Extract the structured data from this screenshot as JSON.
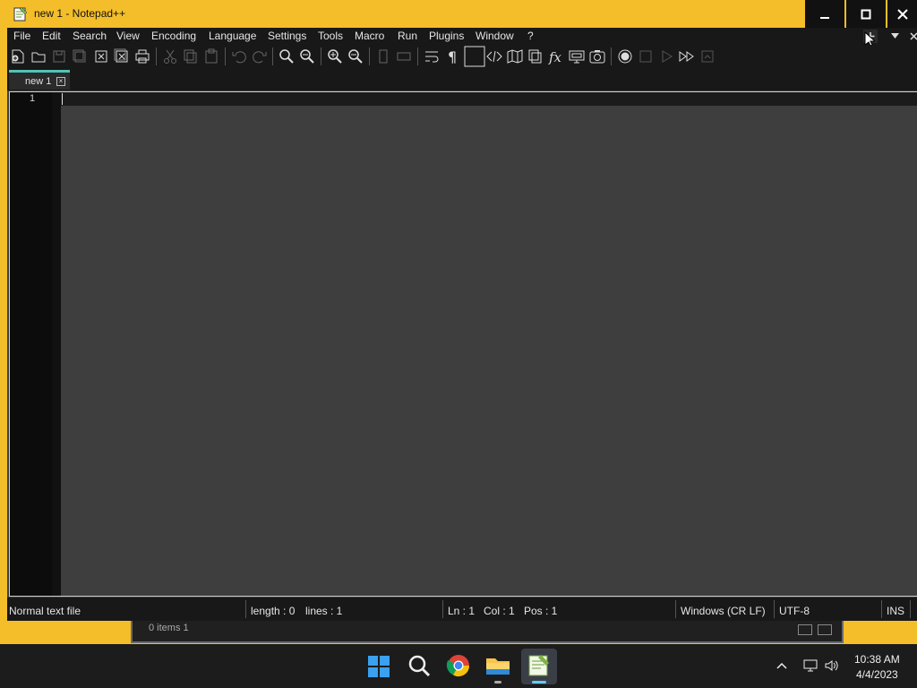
{
  "window": {
    "title": "new 1 - Notepad++",
    "accent_color": "#f4be2a",
    "controls": [
      "minimize",
      "maximize",
      "close"
    ]
  },
  "menu": {
    "items": [
      "File",
      "Edit",
      "Search",
      "View",
      "Encoding",
      "Language",
      "Settings",
      "Tools",
      "Macro",
      "Run",
      "Plugins",
      "Window",
      "?"
    ],
    "right_icons": [
      "add-tab-icon",
      "dropdown-arrow-icon",
      "close-doc-icon"
    ]
  },
  "toolbar": {
    "icons": [
      "new-file-icon",
      "open-file-icon",
      "save-icon",
      "save-all-icon",
      "close-icon",
      "close-all-icon",
      "print-icon",
      "cut-icon",
      "copy-icon",
      "paste-icon",
      "undo-icon",
      "redo-icon",
      "find-icon",
      "replace-icon",
      "zoom-in-icon",
      "zoom-out-icon",
      "sync-vertical-icon",
      "sync-horizontal-icon",
      "word-wrap-icon",
      "show-all-chars-icon",
      "indent-guide-icon",
      "udl-icon",
      "document-map-icon",
      "doc-list-icon",
      "function-list-icon",
      "folder-as-workspace-icon",
      "monitoring-icon",
      "record-macro-icon",
      "stop-macro-icon",
      "play-macro-icon",
      "run-macro-multiple-icon",
      "save-macro-icon"
    ]
  },
  "tabs": [
    {
      "label": "new 1",
      "active": true,
      "accent": "#51c4b6"
    }
  ],
  "editor": {
    "line_numbers": [
      "1"
    ],
    "content": ""
  },
  "status": {
    "file_type": "Normal text file",
    "length": "length : 0",
    "lines": "lines : 1",
    "ln": "Ln : 1",
    "col": "Col : 1",
    "pos": "Pos : 1",
    "eol": "Windows (CR LF)",
    "encoding": "UTF-8",
    "mode": "INS"
  },
  "background_window": {
    "status_text": "0 items   1"
  },
  "taskbar": {
    "apps": [
      "start-icon",
      "search-icon",
      "chrome-icon",
      "file-explorer-icon",
      "notepadpp-icon"
    ],
    "tray_icons": [
      "chevron-up-icon",
      "network-icon",
      "volume-icon"
    ],
    "time": "10:38 AM",
    "date": "4/4/2023"
  }
}
